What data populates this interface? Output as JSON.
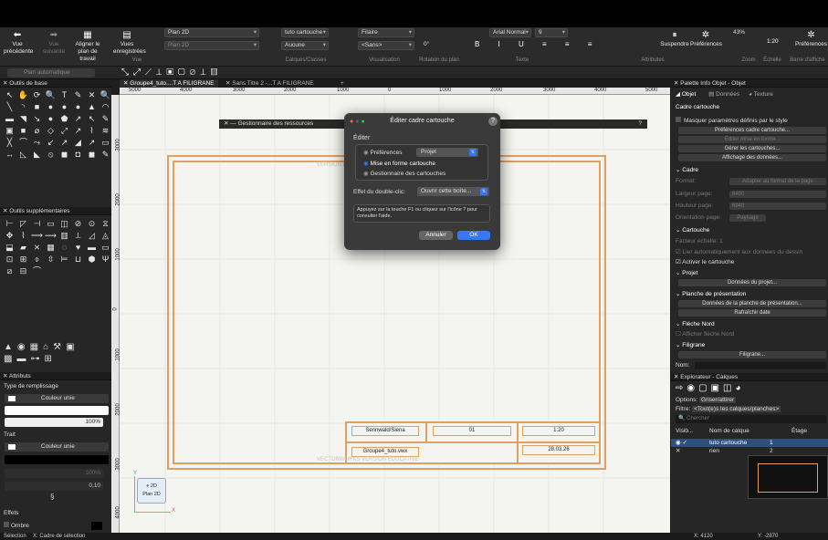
{
  "toolbar": {
    "back": "Vue précédente",
    "forward": "Vue suivante",
    "align_plan": "Aligner le plan de travail",
    "saved_views": "Vues enregistrées",
    "views_group": "Vue",
    "layer_select": "Plan 2D",
    "layer_select2": "Plan 2D",
    "class_select": "tuto cartouche",
    "class_none": "Aucune",
    "classes_group": "Calques/Classes",
    "render_select": "Filaire",
    "projection_select": "<Sans>",
    "rotation": "0°",
    "visualisation_group": "Visualisation",
    "rotation_group": "Rotation du plan",
    "font_select": "Arial Normal",
    "font_size": "9",
    "text_group": "Texte",
    "attributes_group": "Attributes",
    "suspend": "Suspendre",
    "preferences": "Préférences",
    "zoom": "43%",
    "zoom_group": "Zoom",
    "scale": "1:20",
    "scale_group": "Échelle",
    "preferences2": "Préférences",
    "display_bar_group": "Barre d'affiche"
  },
  "subbar": {
    "auto_plan": "Plan automatique"
  },
  "left": {
    "basic_tools_title": "Outils de base",
    "extra_tools_title": "Outils supplémentaires",
    "attributes_title": "Attributs",
    "fill_type_label": "Type de remplissage",
    "fill_color": "Couleur unie",
    "opacity": "100%",
    "trait_label": "Trait",
    "trait_color": "Couleur unie",
    "line_opacity": "100%",
    "line_weight": "0,10",
    "effects_label": "Effets",
    "shadow_label": "Ombre",
    "basic_tools": [
      "↖",
      "✋",
      "⟳",
      "🔍",
      "T",
      "✎",
      "✕",
      "🔍",
      "╲",
      "◝",
      "■",
      "●",
      "●",
      "●",
      "▲",
      "◠",
      "▬",
      "◥",
      "↘",
      "●",
      "⬟",
      "↗",
      "↖",
      "✎",
      "▣",
      "■",
      "⌀",
      "◇",
      "⤢",
      "↗",
      "⌇",
      "≋",
      "╳",
      "⌒",
      "⤳",
      "↙",
      "↗",
      "◢",
      "↗",
      "▭",
      "↔",
      "◺",
      "◣",
      "⦸",
      "◼",
      "◘",
      "◼",
      "✎"
    ],
    "extra_tools": [
      "⊢",
      "◸",
      "⊣",
      "▭",
      "◫",
      "⊘",
      "⊙",
      "⧖",
      "✥",
      "⌇",
      "⟶",
      "⟿",
      "▥",
      "⟂",
      "◿",
      "◬",
      "⬓",
      "▰",
      "⨯",
      "▦",
      "◌",
      "♥",
      "▬",
      "▭",
      "⊡",
      "⊞",
      "⌽",
      "⇳",
      "⊨",
      "⊔",
      "⬢",
      "Ψ",
      "⧄",
      "⊟",
      "⌒"
    ]
  },
  "document": {
    "tab1": "Groupe4_tuto....T A FILIGRANE",
    "tab2": "Sans Titre 2 -...T A FILIGRANE",
    "ruler_h": [
      "5000",
      "4000",
      "3000",
      "2000",
      "1000",
      "0",
      "1000",
      "2000",
      "3000",
      "4000",
      "5000"
    ],
    "ruler_v": [
      "3000",
      "2000",
      "1000",
      "0",
      "1000",
      "2000",
      "3000",
      "4000"
    ],
    "resource_manager": "Gestionnaire des ressources",
    "watermark_top": "VERSION ÉDUCATIVE",
    "cartouche": {
      "c1": "Sennwald/Siena",
      "c2": "01",
      "c3": "1:20",
      "c4": "Groupe4_tuto.vwx",
      "c5": "28.03.26"
    },
    "watermark_bottom": "VECTORWORKS VERSION ÉDUCATIVE",
    "view_badge_1": "2D",
    "view_badge_2": "Plan 2D",
    "axis_y": "Y",
    "axis_x": "X"
  },
  "dialog": {
    "title": "Éditer cadre cartouche",
    "section": "Éditer",
    "opt_prefs": "Préférences",
    "opt_prefs_select": "Projet",
    "opt_layout": "Mise en forme cartouche",
    "opt_manager": "Gestionnaire des cartouches",
    "double_click_label": "Effet du double-clic:",
    "double_click_value": "Ouvrir cette boîte...",
    "help": "Appuyez sur la touche F1 ou cliquez sur l'icône ? pour consulter l'aide.",
    "cancel": "Annuler",
    "ok": "OK"
  },
  "info_palette": {
    "title": "Palette Info Objet - Objet",
    "tab_object": "Objet",
    "tab_data": "Données",
    "tab_texture": "Texture",
    "object_type": "Cadre cartouche",
    "hide_style_params": "Masquer paramètres définis par le style",
    "btn_prefs": "Préférences cadre cartouche...",
    "btn_edit_layout": "Éditer mise en forme...",
    "btn_manage": "Gérer les cartouches...",
    "btn_display_data": "Affichage des données...",
    "frame_section": "Cadre",
    "format_label": "Format:",
    "format_value": "Adapter au format de la page",
    "page_width_label": "Largeur page:",
    "page_width_value": "8400",
    "page_height_label": "Hauteur page:",
    "page_height_value": "6940",
    "orientation_label": "Orientation page:",
    "orientation_value": "Paysage",
    "cartouche_section": "Cartouche",
    "scale_factor": "Facteur échelle:",
    "scale_factor_value": "1",
    "link_auto": "Lier automatiquement aux données du dessin",
    "activate": "Activer le cartouche",
    "project_section": "Projet",
    "btn_project_data": "Données du projet...",
    "layout_section": "Planche de présentation",
    "btn_layout_data": "Données de la planche de présentation...",
    "btn_refresh": "Rafraîchir date",
    "north_section": "Flèche Nord",
    "show_north": "Afficher flèche Nord",
    "watermark_section": "Filigrane",
    "btn_watermark": "Filigrane...",
    "name_label": "Nom:"
  },
  "navigator": {
    "title": "Explorateur - Calques",
    "options_label": "Options:",
    "options_value": "Griser/attirer",
    "filter_label": "Filtre:",
    "filter_value": "<Tout(e)s les calques/planches>",
    "search_placeholder": "Chercher",
    "col_vis": "Visib...",
    "col_name": "Nom de calque",
    "col_stage": "Étage",
    "rows": [
      {
        "name": "tuto cartouche",
        "num": "1"
      },
      {
        "name": "rien",
        "num": "2"
      }
    ]
  },
  "status": {
    "selection": "Sélection",
    "text": "X: Cadre de sélection",
    "x": "X: 4120",
    "y": "Y: -2870"
  },
  "colors": {
    "accent": "#3478f6",
    "frame": "#e0a060",
    "dialog_bg": "#3a3a3a"
  }
}
